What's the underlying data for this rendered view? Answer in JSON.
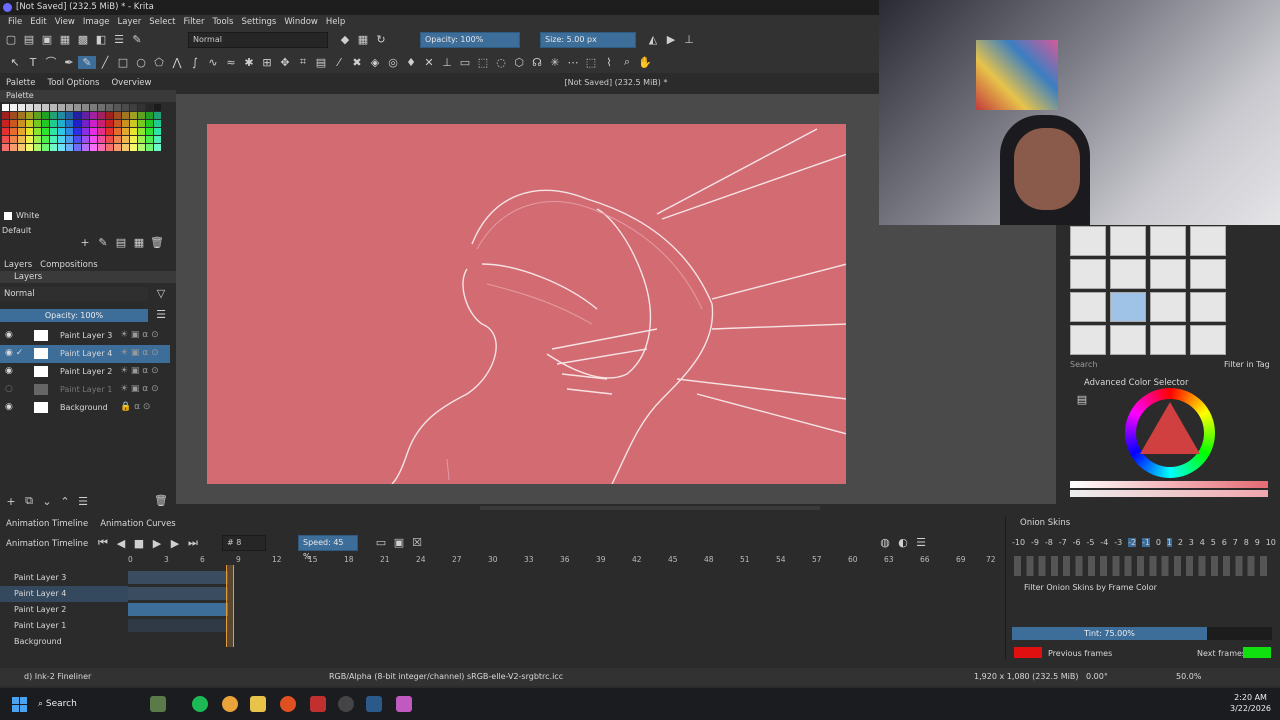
{
  "window": {
    "title": "[Not Saved]  (232.5 MiB) * - Krita"
  },
  "menu": [
    "File",
    "Edit",
    "View",
    "Image",
    "Layer",
    "Select",
    "Filter",
    "Tools",
    "Settings",
    "Window",
    "Help"
  ],
  "toolbar": {
    "blend_mode": "Normal",
    "opacity": "Opacity: 100%",
    "size": "Size: 5.00 px"
  },
  "left_tabs": [
    "Palette",
    "Tool Options",
    "Overview"
  ],
  "palette": {
    "title": "Palette",
    "current": "White",
    "set": "Default"
  },
  "layer_tabs": [
    "Layers",
    "Compositions"
  ],
  "layers_panel": {
    "title": "Layers",
    "blend": "Normal",
    "opacity": "Opacity:  100%",
    "items": [
      {
        "name": "Paint Layer 3"
      },
      {
        "name": "Paint Layer 4"
      },
      {
        "name": "Paint Layer 2"
      },
      {
        "name": "Paint Layer 1"
      },
      {
        "name": "Background"
      }
    ]
  },
  "canvas": {
    "title": "[Not Saved]  (232.5 MiB) *"
  },
  "right": {
    "search": "Search",
    "filter_tag": "Filter in Tag",
    "color_selector": "Advanced Color Selector"
  },
  "timeline": {
    "tabs": [
      "Animation Timeline",
      "Animation Curves"
    ],
    "title": "Animation Timeline",
    "frame": "# 8",
    "speed": "Speed: 45 %",
    "ruler": [
      "0",
      "3",
      "6",
      "9",
      "12",
      "15",
      "18",
      "21",
      "24",
      "27",
      "30",
      "33",
      "36",
      "39",
      "42",
      "45",
      "48",
      "51",
      "54",
      "57",
      "60",
      "63",
      "66",
      "69",
      "72"
    ],
    "layers": [
      "Paint Layer 3",
      "Paint Layer 4",
      "Paint Layer 2",
      "Paint Layer 1",
      "Background"
    ]
  },
  "onion": {
    "title": "Onion Skins",
    "numbers": [
      "-10",
      "-9",
      "-8",
      "-7",
      "-6",
      "-5",
      "-4",
      "-3",
      "-2",
      "-1",
      "0",
      "1",
      "2",
      "3",
      "4",
      "5",
      "6",
      "7",
      "8",
      "9",
      "10"
    ],
    "filter": "Filter Onion Skins by Frame Color",
    "tint": "Tint: 75.00%",
    "tint_value": 0.75,
    "previous": "Previous frames",
    "next": "Next frames",
    "colors": {
      "previous": "#e01010",
      "next": "#10e010"
    }
  },
  "status": {
    "brush": "d) Ink-2 Fineliner",
    "color_space": "RGB/Alpha (8-bit integer/channel)  sRGB-elle-V2-srgbtrc.icc",
    "dims": "1,920 x 1,080 (232.5 MiB)",
    "rotation": "0.00°",
    "zoom": "50.0%"
  },
  "taskbar": {
    "search": "Search",
    "time": "2:20 AM",
    "date": "3/22/2026"
  }
}
